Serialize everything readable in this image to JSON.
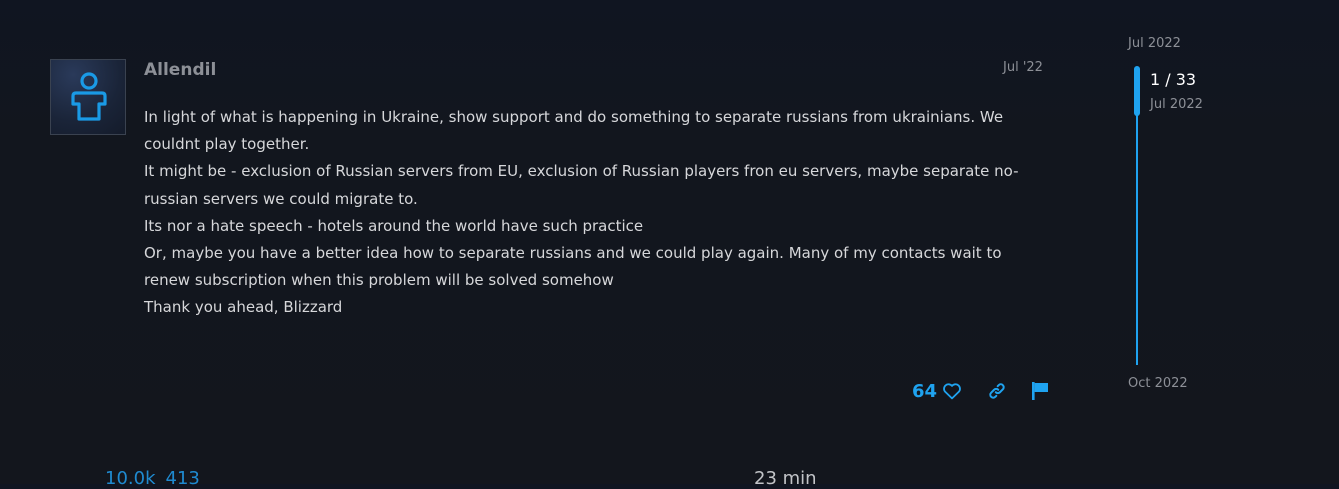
{
  "post": {
    "username": "Allendil",
    "date": "Jul '22",
    "body": [
      "In light of what is happening in Ukraine, show support and do something to separate russians from ukrainians. We couldnt play together.",
      "It might be - exclusion of Russian servers from EU, exclusion of Russian players fron eu servers, maybe separate no-russian servers we could migrate to.",
      "Its nor a hate speech - hotels around the world have such practice",
      "Or, maybe you have a better idea how to separate russians and we could play again. Many of my contacts wait to renew subscription when this problem will be solved somehow",
      "Thank you ahead, Blizzard"
    ],
    "like_count": "64",
    "avatar_icon": "user-silhouette-icon",
    "actions": {
      "like_icon": "heart-icon",
      "link_icon": "link-icon",
      "flag_icon": "flag-icon"
    }
  },
  "timeline": {
    "top_date": "Jul 2022",
    "position": "1 / 33",
    "current_date": "Jul 2022",
    "bottom_date": "Oct 2022"
  },
  "topic_stats": {
    "views": "10.0k",
    "likes": "413",
    "read_time": "23 min"
  },
  "colors": {
    "accent": "#1fa3f0",
    "background": "#13161d",
    "muted_text": "#8d9097",
    "body_text": "#d6d7da"
  }
}
